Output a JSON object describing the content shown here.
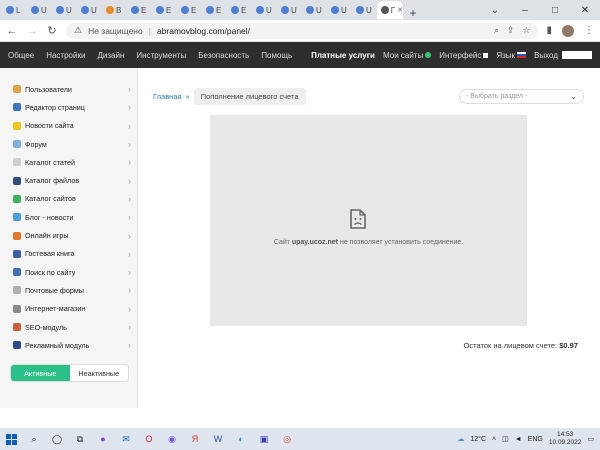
{
  "browser": {
    "tabs": [
      {
        "label": "L",
        "color": "#4a7fd4"
      },
      {
        "label": "U",
        "color": "#4a7fd4"
      },
      {
        "label": "U",
        "color": "#4a7fd4"
      },
      {
        "label": "U",
        "color": "#4a7fd4"
      },
      {
        "label": "B",
        "color": "#f08a24"
      },
      {
        "label": "E",
        "color": "#4a7fd4"
      },
      {
        "label": "E",
        "color": "#4a7fd4"
      },
      {
        "label": "E",
        "color": "#4a7fd4"
      },
      {
        "label": "E",
        "color": "#4a7fd4"
      },
      {
        "label": "E",
        "color": "#4a7fd4"
      },
      {
        "label": "U",
        "color": "#4a7fd4"
      },
      {
        "label": "U",
        "color": "#4a7fd4"
      },
      {
        "label": "U",
        "color": "#4a7fd4"
      },
      {
        "label": "U",
        "color": "#4a7fd4"
      },
      {
        "label": "U",
        "color": "#4a7fd4"
      },
      {
        "label": "Г",
        "color": "#555555",
        "active": true
      }
    ],
    "new_tab": "+",
    "address": {
      "security_label": "Не защищено",
      "url": "abramovblog.com/panel/"
    }
  },
  "topnav": {
    "items": [
      "Общее",
      "Настройки",
      "Дизайн",
      "Инструменты",
      "Безопасность",
      "Помощь"
    ],
    "paid": "Платные услуги",
    "my_sites": "Мои сайты",
    "interface": "Интерфейс",
    "lang": "Язык",
    "logout": "Выход"
  },
  "sidebar": {
    "items": [
      {
        "label": "Пользователи",
        "icon": "users-icon",
        "color": "#e2a24a"
      },
      {
        "label": "Редактор страниц",
        "icon": "page-editor-icon",
        "color": "#3a78c2"
      },
      {
        "label": "Новости сайта",
        "icon": "news-icon",
        "color": "#f0c419"
      },
      {
        "label": "Форум",
        "icon": "forum-icon",
        "color": "#7ab2e6"
      },
      {
        "label": "Каталог статей",
        "icon": "articles-icon",
        "color": "#cfcfcf"
      },
      {
        "label": "Каталог файлов",
        "icon": "files-icon",
        "color": "#2f4f7a"
      },
      {
        "label": "Каталог сайтов",
        "icon": "sites-icon",
        "color": "#3bb25b"
      },
      {
        "label": "Блог - новости",
        "icon": "blog-icon",
        "color": "#4aa0e0"
      },
      {
        "label": "Онлайн игры",
        "icon": "games-icon",
        "color": "#e8772e"
      },
      {
        "label": "Гостевая книга",
        "icon": "guestbook-icon",
        "color": "#3a5ca8"
      },
      {
        "label": "Поиск по сайту",
        "icon": "search-icon",
        "color": "#3a6fb8"
      },
      {
        "label": "Почтовые формы",
        "icon": "mail-forms-icon",
        "color": "#b0b0b0"
      },
      {
        "label": "Интернет-магазин",
        "icon": "shop-icon",
        "color": "#8a8a8a"
      },
      {
        "label": "SEO-модуль",
        "icon": "seo-icon",
        "color": "#d0603a"
      },
      {
        "label": "Рекламный модуль",
        "icon": "ads-icon",
        "color": "#2a4a8c"
      }
    ],
    "toggle": {
      "active": "Активные",
      "inactive": "Неактивные"
    }
  },
  "main": {
    "breadcrumb": {
      "home": "Главная",
      "separator": "»",
      "current": "Пополнение лицевого счета"
    },
    "section_select": {
      "placeholder": "- Выбрать раздел -"
    },
    "error": {
      "prefix": "Сайт",
      "host": "upay.ucoz.net",
      "suffix": "не позволяет установить соединение."
    },
    "balance": {
      "label": "Остаток на лицевом счете:",
      "value": "$0.97"
    }
  },
  "taskbar": {
    "weather": "12°C",
    "lang": "ENG",
    "time": "14:53",
    "date": "10.09.2022"
  },
  "colors": {
    "accent": "#2bbf8a",
    "topnav_bg": "#2e2e2e",
    "link": "#2b7bb9"
  }
}
